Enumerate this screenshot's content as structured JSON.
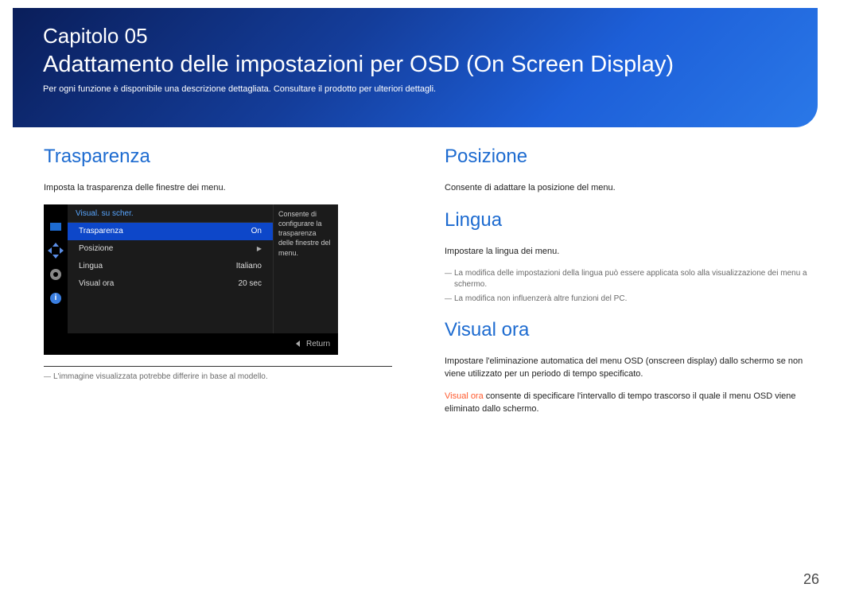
{
  "header": {
    "chapter_label": "Capitolo 05",
    "title": "Adattamento delle impostazioni per OSD (On Screen Display)",
    "subtitle": "Per ogni funzione è disponibile una descrizione dettagliata. Consultare il prodotto per ulteriori dettagli."
  },
  "left": {
    "trasparenza": {
      "heading": "Trasparenza",
      "body": "Imposta la trasparenza delle finestre dei menu."
    },
    "osd": {
      "title": "Visual. su scher.",
      "rows": [
        {
          "label": "Trasparenza",
          "value": "On",
          "selected": true
        },
        {
          "label": "Posizione",
          "value": "",
          "arrow": true
        },
        {
          "label": "Lingua",
          "value": "Italiano"
        },
        {
          "label": "Visual ora",
          "value": "20 sec"
        }
      ],
      "desc": "Consente di configurare la trasparenza delle finestre del menu.",
      "footer_label": "Return",
      "info_icon_text": "i"
    },
    "footnote": "L'immagine visualizzata potrebbe differire in base al modello."
  },
  "right": {
    "posizione": {
      "heading": "Posizione",
      "body": "Consente di adattare la posizione del menu."
    },
    "lingua": {
      "heading": "Lingua",
      "body": "Impostare la lingua dei menu.",
      "note1": "La modifica delle impostazioni della lingua può essere applicata solo alla visualizzazione dei menu a schermo.",
      "note2": "La modifica non influenzerà altre funzioni del PC."
    },
    "visual_ora": {
      "heading": "Visual ora",
      "body1": "Impostare l'eliminazione automatica del menu OSD (onscreen display) dallo schermo se non viene utilizzato per un periodo di tempo specificato.",
      "body2_prefix": "Visual ora",
      "body2_rest": " consente di specificare l'intervallo di tempo trascorso il quale il menu OSD viene eliminato dallo schermo."
    }
  },
  "page_number": "26"
}
